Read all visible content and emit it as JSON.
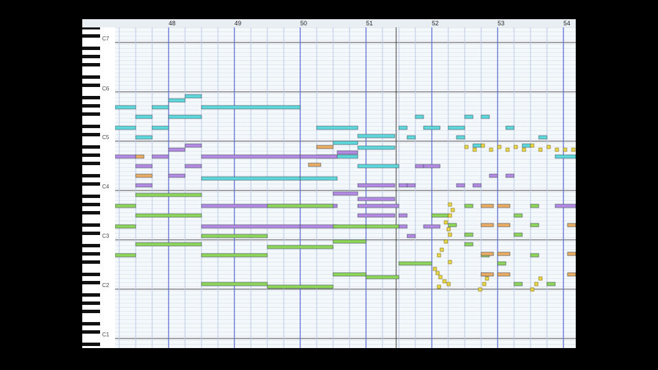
{
  "ruler": {
    "measures": [
      "48",
      "49",
      "50",
      "51",
      "52",
      "53",
      "54"
    ]
  },
  "keyboard": {
    "c_labels": [
      "C7",
      "C6",
      "C5",
      "C4",
      "C3",
      "C2",
      "C1"
    ]
  },
  "colors": {
    "background": "#f4f8fb",
    "bar_line": "#5c6fd0",
    "beat_line": "#b9c9e6",
    "octave_line": "#6d6d6d",
    "track_cyan": "#5fd8dc",
    "track_purple": "#b48ae2",
    "track_green": "#8fd45b",
    "track_orange": "#e9ac62",
    "track_yellow_dot": "#ead74a"
  }
}
